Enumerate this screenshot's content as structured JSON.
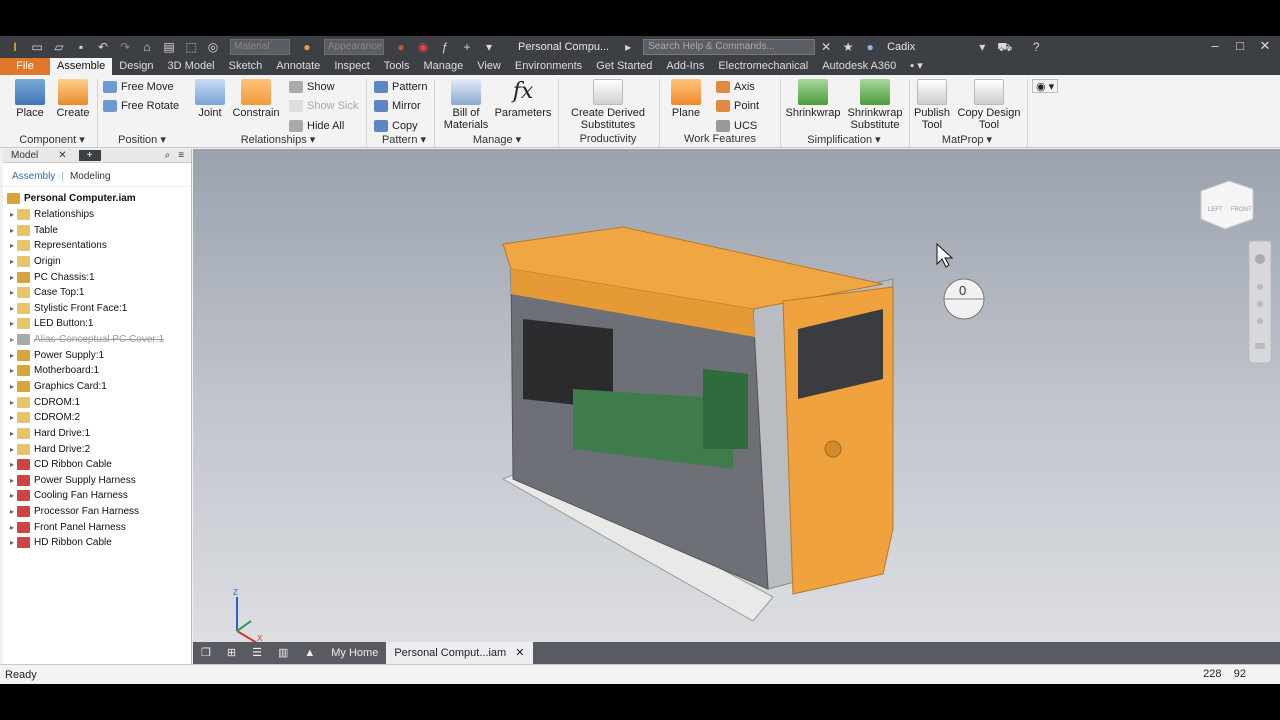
{
  "qat": {
    "dropdown1": "Material",
    "dropdown2": "Appearance",
    "doc_title": "Personal Compu...",
    "search_placeholder": "Search Help & Commands...",
    "user": "Cadix"
  },
  "tabs": [
    "File",
    "Assemble",
    "Design",
    "3D Model",
    "Sketch",
    "Annotate",
    "Inspect",
    "Tools",
    "Manage",
    "View",
    "Environments",
    "Get Started",
    "Add-Ins",
    "Electromechanical",
    "Autodesk A360"
  ],
  "ribbon": {
    "place": "Place",
    "create": "Create",
    "free_move": "Free Move",
    "free_rotate": "Free Rotate",
    "show": "Show",
    "show_sick": "Show Sick",
    "hide_all": "Hide All",
    "joint": "Joint",
    "constrain": "Constrain",
    "pattern": "Pattern",
    "mirror": "Mirror",
    "copy": "Copy",
    "bom_1": "Bill of",
    "bom_2": "Materials",
    "parameters": "Parameters",
    "derived_1": "Create Derived",
    "derived_2": "Substitutes",
    "plane": "Plane",
    "axis": "Axis",
    "point": "Point",
    "ucs": "UCS",
    "shrinkwrap": "Shrinkwrap",
    "shrinkwrap_sub_1": "Shrinkwrap",
    "shrinkwrap_sub_2": "Substitute",
    "publish_1": "Publish",
    "publish_2": "Tool",
    "copy_design_1": "Copy Design",
    "copy_design_2": "Tool",
    "panels": {
      "component": "Component",
      "position": "Position",
      "relationships": "Relationships",
      "pattern": "Pattern",
      "manage": "Manage",
      "productivity": "Productivity",
      "work_features": "Work Features",
      "simplification": "Simplification",
      "matprop": "MatProp"
    }
  },
  "browser": {
    "header": "Model",
    "sub_assembly": "Assembly",
    "sub_modeling": "Modeling",
    "root": "Personal Computer.iam",
    "nodes": [
      "Relationships",
      "Table",
      "Representations",
      "Origin",
      "PC Chassis:1",
      "Case Top:1",
      "Stylistic Front Face:1",
      "LED Button:1",
      "Alias-Conceptual PC Cover:1",
      "Power Supply:1",
      "Motherboard:1",
      "Graphics Card:1",
      "CDROM:1",
      "CDROM:2",
      "Hard Drive:1",
      "Hard Drive:2",
      "CD Ribbon Cable",
      "Power Supply Harness",
      "Cooling Fan Harness",
      "Processor Fan Harness",
      "Front Panel Harness",
      "HD Ribbon Cable"
    ]
  },
  "viewport": {
    "viewcube_left": "LEFT",
    "viewcube_front": "FRONT",
    "mouse_indicator": "0",
    "axis_z": "Z",
    "axis_x": "X"
  },
  "doc_tabs": {
    "home": "My Home",
    "active": "Personal Comput...iam"
  },
  "status": {
    "text": "Ready",
    "coord_x": "228",
    "coord_y": "92"
  },
  "colors": {
    "accent": "#e0782c",
    "chrome": "#3c3f44",
    "case_orange": "#f0a642"
  }
}
